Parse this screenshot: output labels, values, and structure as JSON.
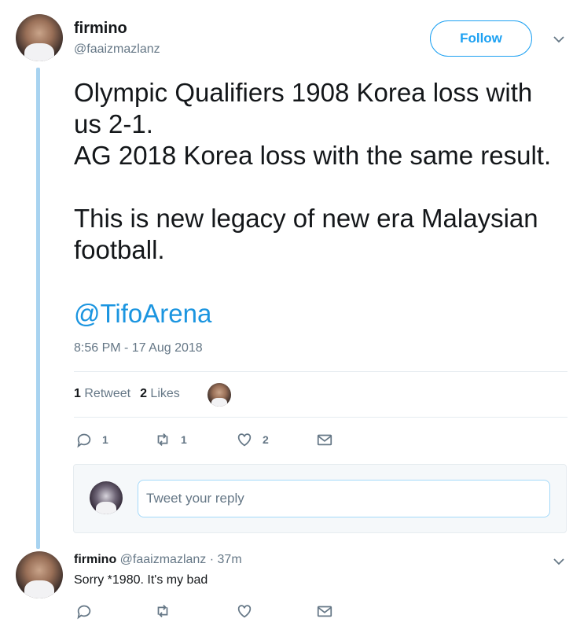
{
  "tweet": {
    "display_name": "firmino",
    "handle": "@faaizmazlanz",
    "follow_label": "Follow",
    "text": "Olympic Qualifiers 1908 Korea loss with\nus 2-1.\nAG 2018 Korea loss with the same result.\n\nThis is new legacy of new era Malaysian\nfootball.",
    "mention": "@TifoArena",
    "timestamp": "8:56 PM - 17 Aug 2018",
    "stats": {
      "retweets_count": "1",
      "retweets_label": "Retweet",
      "likes_count": "2",
      "likes_label": "Likes"
    },
    "actions": {
      "replies": "1",
      "retweets": "1",
      "likes": "2"
    }
  },
  "reply_box": {
    "placeholder": "Tweet your reply"
  },
  "reply": {
    "display_name": "firmino",
    "handle": "@faaizmazlanz",
    "separator": "·",
    "time": "37m",
    "text": "Sorry *1980. It's my bad"
  },
  "colors": {
    "accent": "#1da1f2",
    "thread_line": "#a8d3f0",
    "muted": "#657786"
  }
}
